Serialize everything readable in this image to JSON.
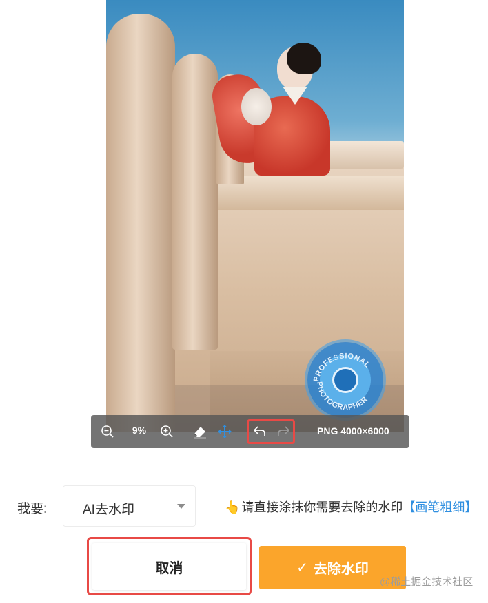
{
  "toolbar": {
    "zoom_level": "9%",
    "image_info": "PNG 4000×6000"
  },
  "watermark_stamp": {
    "text_top": "PROFESSIONAL",
    "text_bottom": "PHOTOGRAPHER"
  },
  "controls": {
    "mode_label": "我要:",
    "mode_selected": "AI去水印",
    "hint_hand": "👆",
    "hint_text": "请直接涂抹你需要去除的水印",
    "hint_link": "【画笔粗细】"
  },
  "actions": {
    "cancel_label": "取消",
    "remove_label": "去除水印",
    "remove_check": "✓"
  },
  "credit": "@稀土掘金技术社区",
  "colors": {
    "accent_orange": "#fba52b",
    "highlight_red": "#e84a46",
    "link_blue": "#2f8fe0"
  }
}
